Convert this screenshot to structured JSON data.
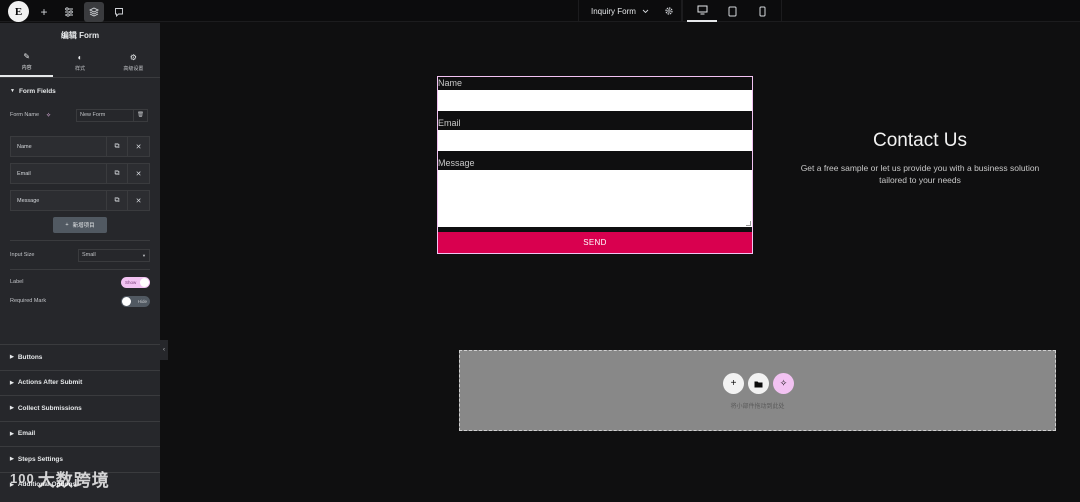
{
  "topbar": {
    "logo_letter": "E",
    "document_title": "Inquiry Form",
    "icons": [
      "elementor-logo-icon",
      "plus-icon",
      "sliders-icon",
      "layers-icon",
      "comment-icon",
      "chevron-down-icon",
      "gear-icon",
      "desktop-icon",
      "tablet-icon",
      "mobile-icon"
    ]
  },
  "sidebar": {
    "title": "编辑 Form",
    "tabs": [
      {
        "label": "内容",
        "icon": "pencil-icon",
        "active": true
      },
      {
        "label": "样式",
        "icon": "contrast-icon",
        "active": false
      },
      {
        "label": "高级设置",
        "icon": "gear-icon",
        "active": false
      }
    ],
    "form_fields_section": "Form Fields",
    "form_name_label": "Form Name",
    "form_name_value": "New Form",
    "fields": [
      {
        "label": "Name"
      },
      {
        "label": "Email"
      },
      {
        "label": "Message"
      }
    ],
    "add_item_label": "新增项目",
    "input_size_label": "Input Size",
    "input_size_value": "Small",
    "label_label": "Label",
    "label_toggle": "Show",
    "required_mark_label": "Required Mark",
    "required_mark_toggle": "Hide",
    "accordions": [
      "Buttons",
      "Actions After Submit",
      "Collect Submissions",
      "Email",
      "Steps Settings",
      "Additional Options"
    ]
  },
  "canvas": {
    "form": {
      "name_label": "Name",
      "email_label": "Email",
      "message_label": "Message",
      "send_label": "SEND"
    },
    "contact": {
      "heading": "Contact Us",
      "text": "Get a free sample or let us provide you with a business solution tailored to your needs"
    },
    "dropzone": {
      "hint": "将小部件拖动到此处"
    }
  },
  "watermark": {
    "logo": "100",
    "text": "大数跨境"
  },
  "colors": {
    "accent_pink": "#f2c2f2",
    "send_button": "#d9004f",
    "panel": "#26272b",
    "canvas": "#0f0f10"
  }
}
